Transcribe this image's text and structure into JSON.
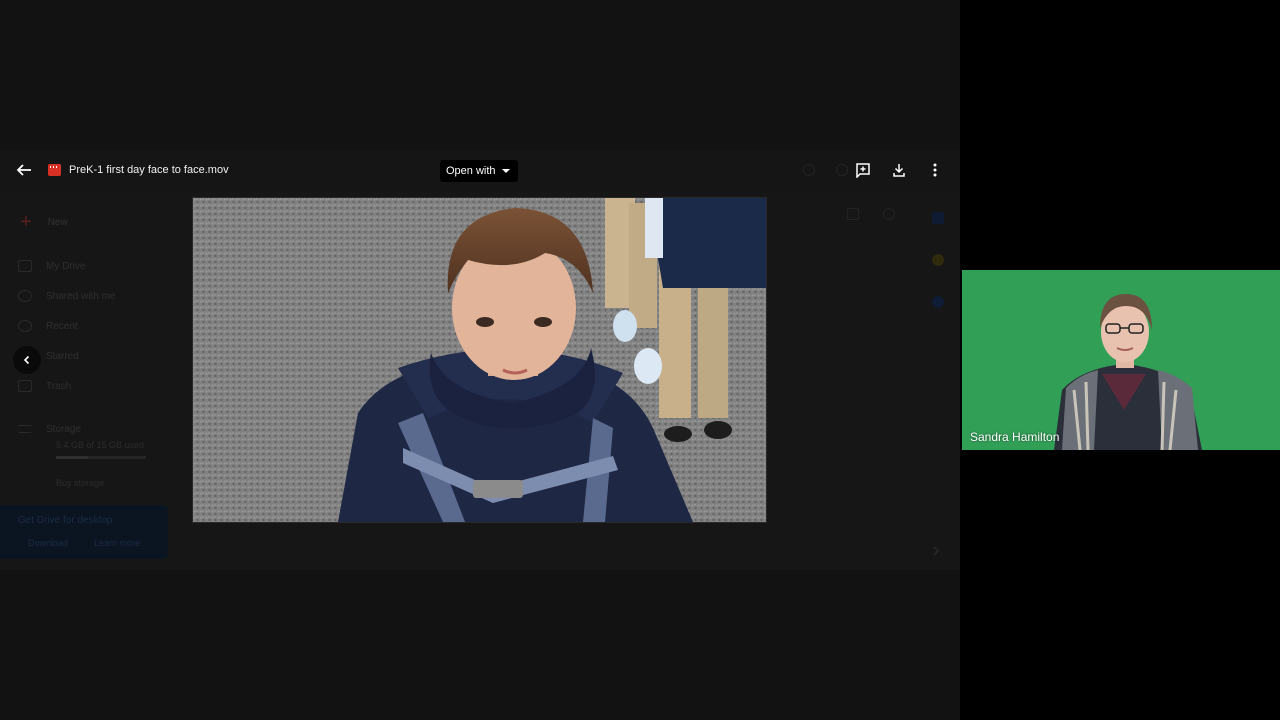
{
  "viewer": {
    "file_title": "PreK-1 first day face to face.mov",
    "open_with_label": "Open with",
    "icons": {
      "back": "arrow-left-icon",
      "file": "video-file-icon",
      "add_comment": "add-comment-icon",
      "download": "download-icon",
      "more": "more-vert-icon",
      "next": "chevron-right-icon"
    }
  },
  "drive_background": {
    "new_label": "New",
    "sidebar_items": [
      {
        "label": "My Drive",
        "icon": "drive-icon"
      },
      {
        "label": "Shared with me",
        "icon": "people-icon"
      },
      {
        "label": "Recent",
        "icon": "clock-icon"
      },
      {
        "label": "Starred",
        "icon": "star-icon"
      },
      {
        "label": "Trash",
        "icon": "trash-icon"
      }
    ],
    "storage": {
      "label": "Storage",
      "usage_text": "5.4 GB of 15 GB used",
      "buy_label": "Buy storage",
      "used_fraction": 0.36
    },
    "promo": {
      "title": "Get Drive for desktop",
      "download_label": "Download",
      "learn_more_label": "Learn more"
    }
  },
  "participant": {
    "name": "Sandra Hamilton"
  },
  "colors": {
    "overlay": "#121212",
    "file_icon": "#d93025",
    "green_screen": "#34a35a",
    "open_with_bg": "#000000"
  }
}
